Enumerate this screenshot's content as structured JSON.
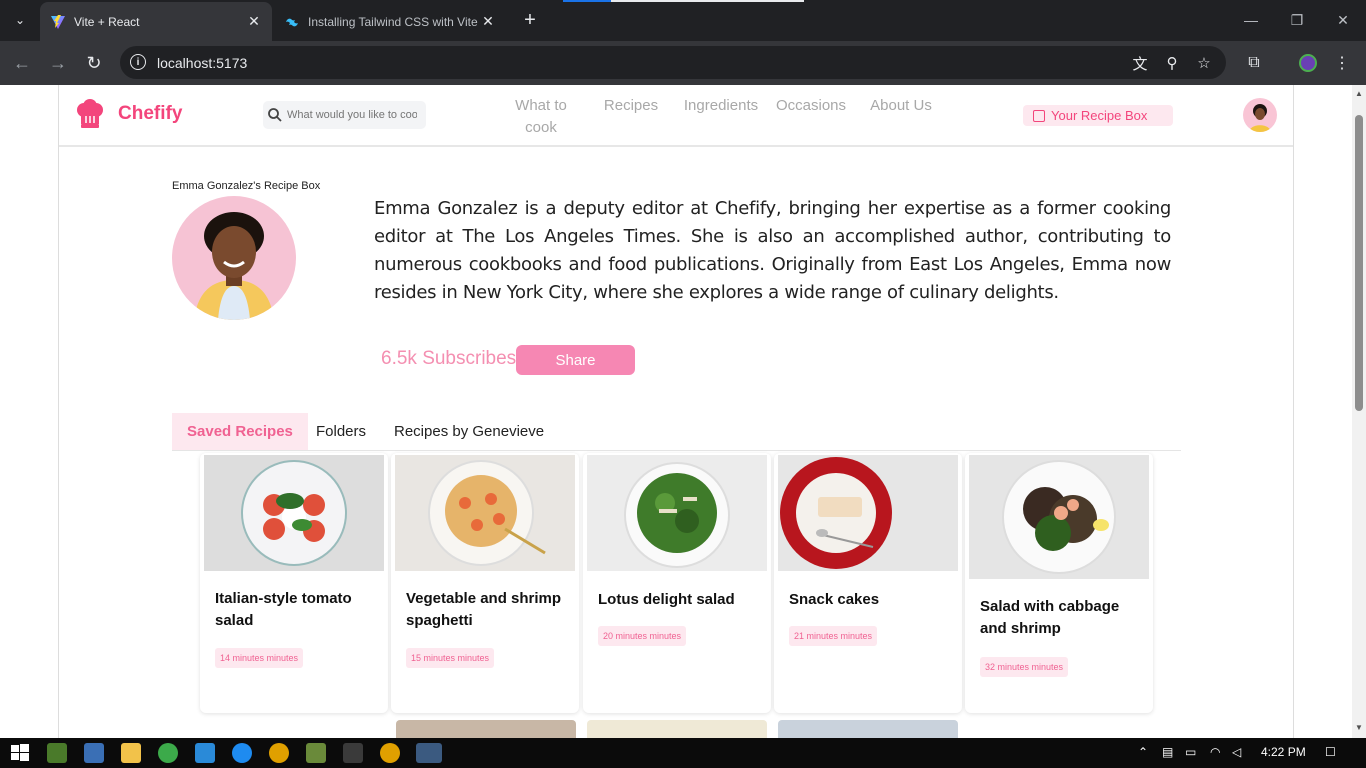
{
  "browser": {
    "tabs": [
      {
        "title": "Vite + React",
        "active": true
      },
      {
        "title": "Installing Tailwind CSS with Vite",
        "active": false
      }
    ],
    "url": "localhost:5173"
  },
  "header": {
    "brand": "Chefify",
    "search_placeholder": "What would you like to cook?",
    "nav": [
      "What to cook",
      "Recipes",
      "Ingredients",
      "Occasions",
      "About Us"
    ],
    "recipe_box_label": "Your Recipe Box"
  },
  "profile": {
    "box_title": "Emma Gonzalez's Recipe Box",
    "bio": "Emma Gonzalez is a deputy editor at Chefify, bringing her expertise as a former cooking editor at The Los Angeles Times. She is also an accomplished author, contributing to numerous cookbooks and food publications. Originally from East Los Angeles, Emma now resides in New York City, where she explores a wide range of culinary delights.",
    "subscribes": "6.5k Subscribes",
    "share_label": "Share"
  },
  "tabs": [
    "Saved Recipes",
    "Folders",
    "Recipes by Genevieve"
  ],
  "recipes": [
    {
      "title": "Italian-style tomato salad",
      "time": "14 minutes minutes"
    },
    {
      "title": "Vegetable and shrimp spaghetti",
      "time": "15 minutes minutes"
    },
    {
      "title": "Lotus delight salad",
      "time": "20 minutes minutes"
    },
    {
      "title": "Snack cakes",
      "time": "21 minutes minutes"
    },
    {
      "title": "Salad with cabbage and shrimp",
      "time": "32 minutes minutes"
    }
  ],
  "taskbar": {
    "time": "4:22 PM"
  },
  "colors": {
    "brand": "#f3457c",
    "accent_light": "#fde8ef",
    "share_bg": "#f687b3"
  }
}
